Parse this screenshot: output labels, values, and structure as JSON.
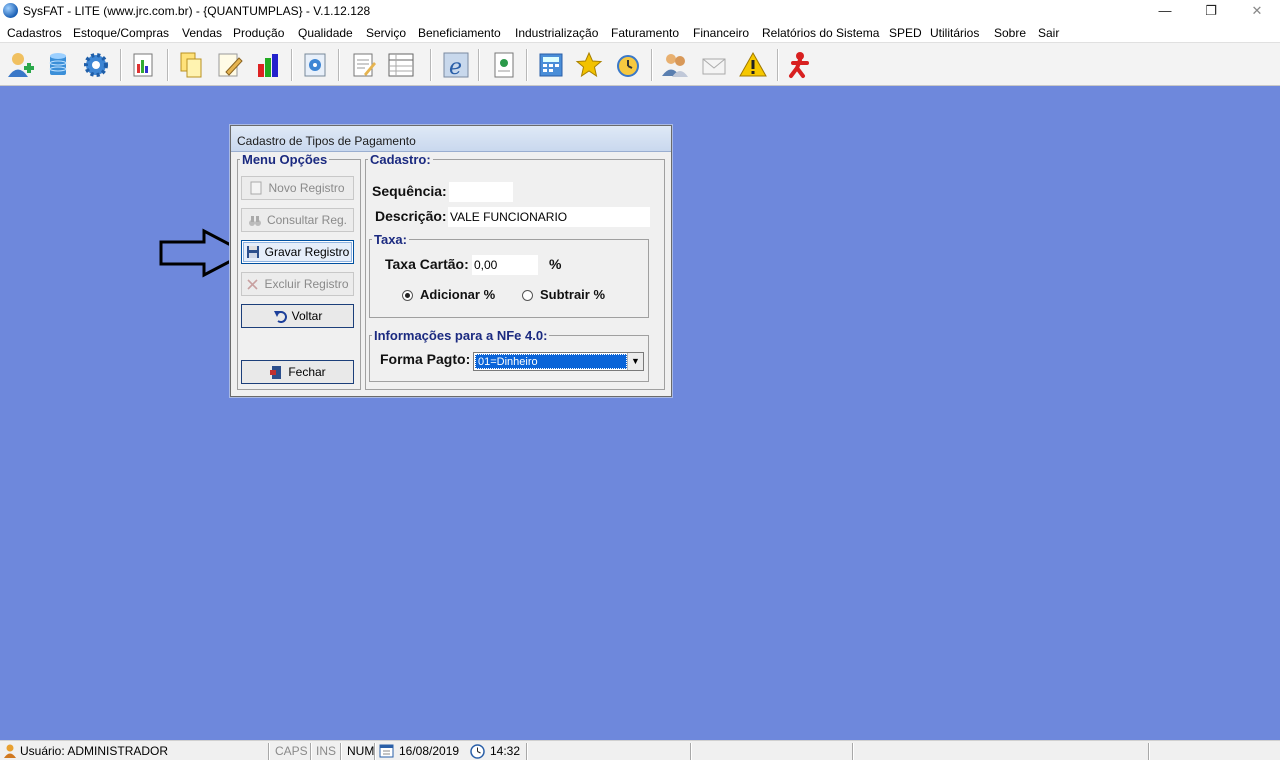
{
  "window": {
    "title": "SysFAT - LITE (www.jrc.com.br) - {QUANTUMPLAS} - V.1.12.128",
    "minimize_glyph": "—",
    "restore_glyph": "❐",
    "close_glyph": "✕"
  },
  "menu": [
    "Cadastros",
    "Estoque/Compras",
    "Vendas",
    "Produção",
    "Qualidade",
    "Serviço",
    "Beneficiamento",
    "Industrialização",
    "Faturamento",
    "Financeiro",
    "Relatórios do Sistema",
    "SPED",
    "Utilitários",
    "Sobre",
    "Sair"
  ],
  "toolbar_icons": [
    "user-add-icon",
    "database-icon",
    "gear-icon",
    "document-chart-icon",
    "copy-icon",
    "edit-icon",
    "bar-chart-icon",
    "settings-doc-icon",
    "notepad-icon",
    "spreadsheet-icon",
    "nfe-icon",
    "report-icon",
    "calculator-icon",
    "star-icon",
    "alarm-clock-icon",
    "users-icon",
    "mail-icon",
    "warning-icon",
    "exit-runner-icon"
  ],
  "dialog": {
    "title": "Cadastro de Tipos de Pagamento",
    "menu_group": {
      "legend": "Menu Opções",
      "buttons": {
        "novo": "Novo Registro",
        "consultar": "Consultar Reg.",
        "gravar": "Gravar Registro",
        "excluir": "Excluir Registro",
        "voltar": "Voltar",
        "fechar": "Fechar"
      }
    },
    "cadastro": {
      "legend": "Cadastro:",
      "sequencia_label": "Sequência:",
      "sequencia_value": "",
      "descricao_label": "Descrição:",
      "descricao_value": "VALE FUNCIONARIO",
      "taxa": {
        "legend": "Taxa:",
        "taxa_label": "Taxa Cartão:",
        "taxa_value": "0,00",
        "percent": "%",
        "adicionar": "Adicionar %",
        "subtrair": "Subtrair %",
        "selected": "adicionar"
      },
      "nfe": {
        "legend": "Informações para a NFe 4.0:",
        "forma_label": "Forma Pagto:",
        "forma_value": "01=Dinheiro"
      }
    }
  },
  "statusbar": {
    "usuario": "Usuário: ADMINISTRADOR",
    "caps": "CAPS",
    "ins": "INS",
    "num": "NUM",
    "date": "16/08/2019",
    "time": "14:32"
  },
  "colors": {
    "desktop": "#6e88dc",
    "legend_text": "#1b2a80",
    "selection": "#0a64d8"
  }
}
